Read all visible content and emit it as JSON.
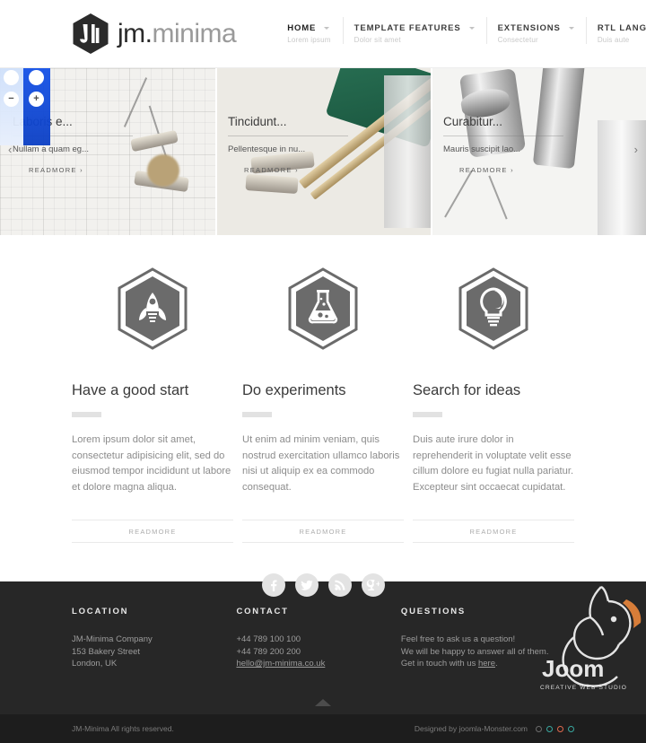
{
  "header": {
    "logo_text_bold": "jm.",
    "logo_text_light": "minima",
    "logo_icon": "hexagon-jm-logo",
    "nav": [
      {
        "label": "HOME",
        "sub": "Lorem ipsum",
        "active": true
      },
      {
        "label": "TEMPLATE FEATURES",
        "sub": "Dolor sit amet",
        "active": false
      },
      {
        "label": "EXTENSIONS",
        "sub": "Consectetur",
        "active": false
      },
      {
        "label": "RTL LANGUAGES",
        "sub": "Duis aute",
        "active": false
      }
    ]
  },
  "slider": {
    "prev_arrow": "‹",
    "next_arrow": "›",
    "zoom_in": "+",
    "zoom_out": "−",
    "slides": [
      {
        "title": "Laboris e...",
        "desc": "Nullam a quam eg...",
        "readmore": "READMORE ›"
      },
      {
        "title": "Tincidunt...",
        "desc": "Pellentesque in nu...",
        "readmore": "READMORE ›"
      },
      {
        "title": "Curabitur...",
        "desc": "Mauris suscipit lao...",
        "readmore": "READMORE ›"
      }
    ]
  },
  "features": [
    {
      "icon": "rocket-icon",
      "title": "Have a good start",
      "text": "Lorem ipsum dolor sit amet, consectetur adipisicing elit, sed do eiusmod tempor incididunt ut labore et dolore magna aliqua.",
      "readmore": "READMORE"
    },
    {
      "icon": "flask-icon",
      "title": "Do experiments",
      "text": "Ut enim ad minim veniam, quis nostrud exercitation ullamco laboris nisi ut aliquip ex ea commodo consequat.",
      "readmore": "READMORE"
    },
    {
      "icon": "lightbulb-icon",
      "title": "Search for ideas",
      "text": "Duis aute irure dolor in reprehenderit in voluptate velit esse cillum dolore eu fugiat nulla pariatur. Excepteur sint occaecat cupidatat.",
      "readmore": "READMORE"
    }
  ],
  "social": [
    {
      "name": "facebook-icon",
      "glyph": "f"
    },
    {
      "name": "twitter-icon",
      "glyph": "t"
    },
    {
      "name": "rss-icon",
      "glyph": "r"
    },
    {
      "name": "google-plus-icon",
      "glyph": "g"
    }
  ],
  "footer": {
    "location": {
      "title": "LOCATION",
      "lines": [
        "JM-Minima Company",
        "153 Bakery Street",
        "London, UK"
      ]
    },
    "contact": {
      "title": "CONTACT",
      "phone1": "+44 789 100 100",
      "phone2": "+44 789 200 200",
      "email": "hello@jm-minima.co.uk"
    },
    "questions": {
      "title": "QUESTIONS",
      "line1": "Feel free to ask us a question!",
      "line2": "We will be happy to answer all of them.",
      "line3_pre": "Get in touch with us ",
      "line3_link": "here",
      "line3_post": "."
    },
    "watermark": "JoomlaMonster",
    "watermark_sub": "CREATIVE WEB STUDIO",
    "back_to_top": "back-to-top"
  },
  "copyright": {
    "left": "JM-Minima All rights reserved.",
    "right": "Designed by joomla-Monster.com",
    "dots": [
      "#6b6b6b",
      "#3aa8a0",
      "#e06a4e",
      "#3aa8a0"
    ]
  },
  "colors": {
    "footer_bg": "#272727",
    "copybar_bg": "#1d1d1d",
    "hex_gray": "#6b6b6b",
    "text_dark": "#3a3a3a",
    "text_muted": "#8c8c8c"
  }
}
